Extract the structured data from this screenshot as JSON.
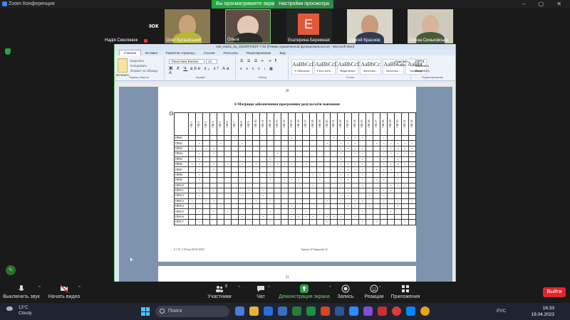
{
  "zoom": {
    "app_title": "Zoom Конференция",
    "share_banner": "Вы просматриваете экран Ольга",
    "view_options": "Настройки просмотра",
    "speaker_label": "Надія Смолянюк",
    "participants": [
      {
        "name": "Надія Смолянюк"
      },
      {
        "name": "Олег Бугаєвський"
      },
      {
        "name": "Ольга"
      },
      {
        "name": "Екатерина Бережная",
        "initial": "E"
      },
      {
        "name": "Сергей Краснов"
      },
      {
        "name": "Олена Синьковська"
      }
    ],
    "toolbar": {
      "mute": "Выключить звук",
      "video": "Начать видео",
      "participants": "Участники",
      "participants_count": "6",
      "chat": "Чат",
      "share": "Демонстрация экрана",
      "record": "Запись",
      "reactions": "Реакции",
      "apps": "Приложения",
      "exit": "Выйти"
    }
  },
  "word": {
    "title": "192_Maslo_ba_2023ПРОЕКТ-7-04 (Режим ограниченной функциональности) - Microsoft Word",
    "tabs": [
      "Главная",
      "Вставка",
      "Разметка страницы",
      "Ссылки",
      "Рассылки",
      "Рецензирование",
      "Вид"
    ],
    "active_tab": "Главная",
    "ribbon": {
      "paste": "Вставить",
      "cut": "Вырезать",
      "copy": "Копировать",
      "format_painter": "Формат по образцу",
      "clipboard_group": "Буфер обмена",
      "font_name": "Times New Roman",
      "font_size": "14",
      "font_group": "Шрифт",
      "paragraph_group": "Абзац",
      "styles_group": "Стили",
      "editing_group": "Редактирование",
      "styles": [
        {
          "sample": "AaBbCcDc",
          "name": "¶ Обычный"
        },
        {
          "sample": "AaBbCcDc",
          "name": "¶ Без инте..."
        },
        {
          "sample": "AaBbCcDc",
          "name": "Выделение"
        },
        {
          "sample": "AaBbCc",
          "name": "Заголово..."
        },
        {
          "sample": "AaBbCc",
          "name": "Заголово..."
        },
        {
          "sample": "AaBbC",
          "name": "Название"
        }
      ],
      "change_styles": "Изменить стили",
      "find": "Найти",
      "replace": "Заменить",
      "select": "Выделить"
    },
    "page_number": "20",
    "next_page_number": "21",
    "heading": "6 Матриця забезпечення програмних результатів навчання",
    "status_left": "§ 1 Ε| 1-20 від 26.03.2023",
    "status_right": "Аркуш 22 Аркушів 22",
    "columns": [
      "ОК 1",
      "ОК 2",
      "ОК 3",
      "ОК 4",
      "ОК 5",
      "ОК 6",
      "ОК 7",
      "ОК 8",
      "ОК 9",
      "ОК 10",
      "ОК 11",
      "ОК 12",
      "ОК 13",
      "ОК 14",
      "ОК 15",
      "ОК 16",
      "ОК 17",
      "ОК 18",
      "ОК 19",
      "ОК 20",
      "ОК 21",
      "ОК 22",
      "ОК 23",
      "ОК 24",
      "ОК 25",
      "ОК 26",
      "ОК 27",
      "ОК 28",
      "ОК 29",
      "ОК 30",
      "ОК 31",
      "ОК 32"
    ],
    "rows": [
      {
        "label": "ПРН1",
        "cells": "......+.......+.....+.+++..+....."
      },
      {
        "label": "ПРН2",
        "cells": ".+..+..+...........+.+++..++++++."
      },
      {
        "label": "ПРН3",
        "cells": "+.++.........+.......++++..+++++."
      },
      {
        "label": "ПРН4",
        "cells": ".+.+........+........+.++..+++++."
      },
      {
        "label": "ПРН5",
        "cells": ".+.........+.........+..+..+.+..."
      },
      {
        "label": "ПРН6",
        "cells": "++.+.+.+.+.++++.+....++++..++++++"
      },
      {
        "label": "ПРН7",
        "cells": ".+.+.....+...........++++.+++.+.."
      },
      {
        "label": "ПРН8",
        "cells": ".+.........+.....++..++.+..+.+..."
      },
      {
        "label": "ПРН9",
        "cells": ".+.....+...+.+++..+..++.+.++.+..+"
      },
      {
        "label": "ПРН10",
        "cells": "...............+.+...+..+...+++.+"
      },
      {
        "label": "ПРН11",
        "cells": ".+.+....+.+..+......+.++..+++...+"
      },
      {
        "label": "ПРН12",
        "cells": ".+.....+..+..........++..+.+....+"
      },
      {
        "label": "ПРН13",
        "cells": "+.++.....+.+.......+.+.++..+.+.+."
      },
      {
        "label": "ПРН14",
        "cells": "+...+.........+.......++.+.+.+..."
      },
      {
        "label": "ПРН15",
        "cells": ".+.+.+.....+..+.+.+.....+...+...+"
      },
      {
        "label": "ПРН16",
        "cells": ".......+..+...++++.+++.+........+"
      },
      {
        "label": "ПРН17",
        "cells": ".+.........+.......+.+..+.+...+.+"
      }
    ]
  },
  "taskbar": {
    "weather_temp": "13°C",
    "weather_desc": "Cloudy",
    "search_placeholder": "Поиск",
    "language": "РУС",
    "time": "16:33",
    "date": "19.04.2023"
  },
  "colors": {
    "zoom_green": "#23a541",
    "exit_red": "#e0262f",
    "active_speaker_border": "#6bd36b"
  }
}
